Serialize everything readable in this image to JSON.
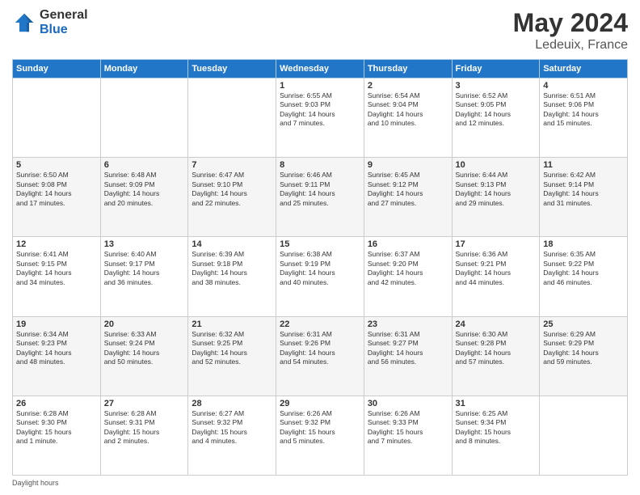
{
  "header": {
    "logo_general": "General",
    "logo_blue": "Blue",
    "title": "May 2024",
    "location": "Ledeuix, France"
  },
  "calendar": {
    "days_of_week": [
      "Sunday",
      "Monday",
      "Tuesday",
      "Wednesday",
      "Thursday",
      "Friday",
      "Saturday"
    ],
    "weeks": [
      [
        {
          "day": "",
          "info": ""
        },
        {
          "day": "",
          "info": ""
        },
        {
          "day": "",
          "info": ""
        },
        {
          "day": "1",
          "info": "Sunrise: 6:55 AM\nSunset: 9:03 PM\nDaylight: 14 hours\nand 7 minutes."
        },
        {
          "day": "2",
          "info": "Sunrise: 6:54 AM\nSunset: 9:04 PM\nDaylight: 14 hours\nand 10 minutes."
        },
        {
          "day": "3",
          "info": "Sunrise: 6:52 AM\nSunset: 9:05 PM\nDaylight: 14 hours\nand 12 minutes."
        },
        {
          "day": "4",
          "info": "Sunrise: 6:51 AM\nSunset: 9:06 PM\nDaylight: 14 hours\nand 15 minutes."
        }
      ],
      [
        {
          "day": "5",
          "info": "Sunrise: 6:50 AM\nSunset: 9:08 PM\nDaylight: 14 hours\nand 17 minutes."
        },
        {
          "day": "6",
          "info": "Sunrise: 6:48 AM\nSunset: 9:09 PM\nDaylight: 14 hours\nand 20 minutes."
        },
        {
          "day": "7",
          "info": "Sunrise: 6:47 AM\nSunset: 9:10 PM\nDaylight: 14 hours\nand 22 minutes."
        },
        {
          "day": "8",
          "info": "Sunrise: 6:46 AM\nSunset: 9:11 PM\nDaylight: 14 hours\nand 25 minutes."
        },
        {
          "day": "9",
          "info": "Sunrise: 6:45 AM\nSunset: 9:12 PM\nDaylight: 14 hours\nand 27 minutes."
        },
        {
          "day": "10",
          "info": "Sunrise: 6:44 AM\nSunset: 9:13 PM\nDaylight: 14 hours\nand 29 minutes."
        },
        {
          "day": "11",
          "info": "Sunrise: 6:42 AM\nSunset: 9:14 PM\nDaylight: 14 hours\nand 31 minutes."
        }
      ],
      [
        {
          "day": "12",
          "info": "Sunrise: 6:41 AM\nSunset: 9:15 PM\nDaylight: 14 hours\nand 34 minutes."
        },
        {
          "day": "13",
          "info": "Sunrise: 6:40 AM\nSunset: 9:17 PM\nDaylight: 14 hours\nand 36 minutes."
        },
        {
          "day": "14",
          "info": "Sunrise: 6:39 AM\nSunset: 9:18 PM\nDaylight: 14 hours\nand 38 minutes."
        },
        {
          "day": "15",
          "info": "Sunrise: 6:38 AM\nSunset: 9:19 PM\nDaylight: 14 hours\nand 40 minutes."
        },
        {
          "day": "16",
          "info": "Sunrise: 6:37 AM\nSunset: 9:20 PM\nDaylight: 14 hours\nand 42 minutes."
        },
        {
          "day": "17",
          "info": "Sunrise: 6:36 AM\nSunset: 9:21 PM\nDaylight: 14 hours\nand 44 minutes."
        },
        {
          "day": "18",
          "info": "Sunrise: 6:35 AM\nSunset: 9:22 PM\nDaylight: 14 hours\nand 46 minutes."
        }
      ],
      [
        {
          "day": "19",
          "info": "Sunrise: 6:34 AM\nSunset: 9:23 PM\nDaylight: 14 hours\nand 48 minutes."
        },
        {
          "day": "20",
          "info": "Sunrise: 6:33 AM\nSunset: 9:24 PM\nDaylight: 14 hours\nand 50 minutes."
        },
        {
          "day": "21",
          "info": "Sunrise: 6:32 AM\nSunset: 9:25 PM\nDaylight: 14 hours\nand 52 minutes."
        },
        {
          "day": "22",
          "info": "Sunrise: 6:31 AM\nSunset: 9:26 PM\nDaylight: 14 hours\nand 54 minutes."
        },
        {
          "day": "23",
          "info": "Sunrise: 6:31 AM\nSunset: 9:27 PM\nDaylight: 14 hours\nand 56 minutes."
        },
        {
          "day": "24",
          "info": "Sunrise: 6:30 AM\nSunset: 9:28 PM\nDaylight: 14 hours\nand 57 minutes."
        },
        {
          "day": "25",
          "info": "Sunrise: 6:29 AM\nSunset: 9:29 PM\nDaylight: 14 hours\nand 59 minutes."
        }
      ],
      [
        {
          "day": "26",
          "info": "Sunrise: 6:28 AM\nSunset: 9:30 PM\nDaylight: 15 hours\nand 1 minute."
        },
        {
          "day": "27",
          "info": "Sunrise: 6:28 AM\nSunset: 9:31 PM\nDaylight: 15 hours\nand 2 minutes."
        },
        {
          "day": "28",
          "info": "Sunrise: 6:27 AM\nSunset: 9:32 PM\nDaylight: 15 hours\nand 4 minutes."
        },
        {
          "day": "29",
          "info": "Sunrise: 6:26 AM\nSunset: 9:32 PM\nDaylight: 15 hours\nand 5 minutes."
        },
        {
          "day": "30",
          "info": "Sunrise: 6:26 AM\nSunset: 9:33 PM\nDaylight: 15 hours\nand 7 minutes."
        },
        {
          "day": "31",
          "info": "Sunrise: 6:25 AM\nSunset: 9:34 PM\nDaylight: 15 hours\nand 8 minutes."
        },
        {
          "day": "",
          "info": ""
        }
      ]
    ]
  },
  "footer": {
    "note": "Daylight hours"
  }
}
